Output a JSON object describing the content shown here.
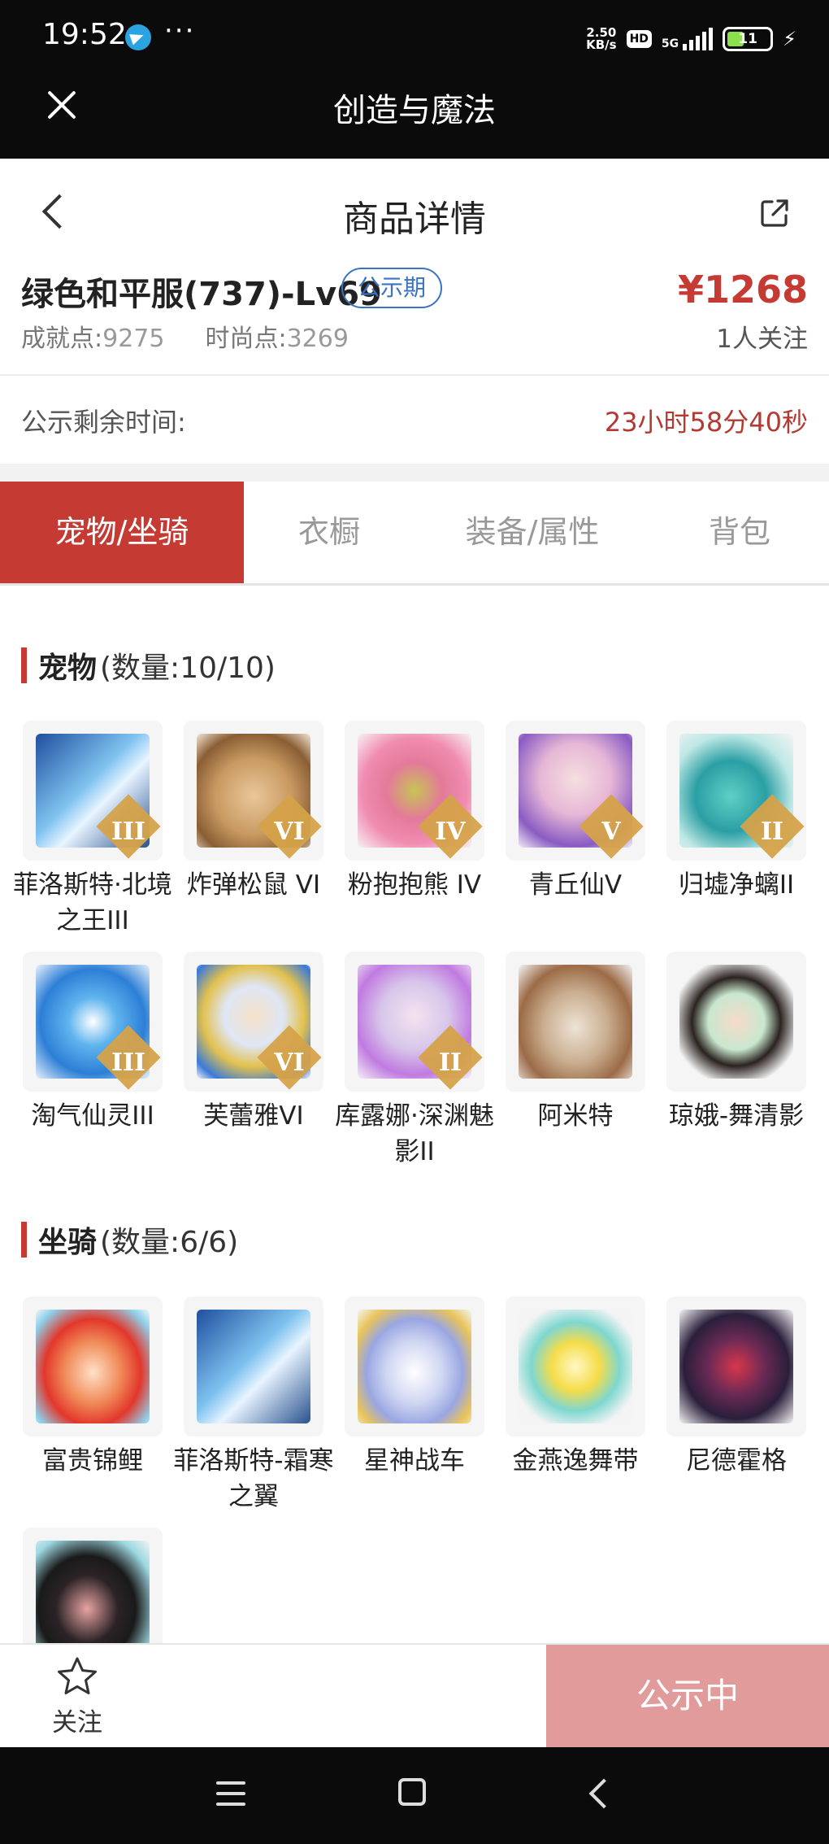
{
  "status_bar": {
    "time": "19:52",
    "speed_value": "2.50",
    "speed_unit": "KB/s",
    "hd": "HD",
    "network": "5G",
    "battery": "11"
  },
  "app_bar": {
    "title": "创造与魔法"
  },
  "header": {
    "title": "商品详情"
  },
  "product": {
    "name": "绿色和平服(737)-Lv69",
    "badge": "公示期",
    "price": "¥1268",
    "achievement_label": "成就点:",
    "achievement_value": "9275",
    "fashion_label": "时尚点:",
    "fashion_value": "3269",
    "watchers": "1人关注"
  },
  "remaining": {
    "label": "公示剩余时间:",
    "value": "23小时58分40秒"
  },
  "tabs": [
    {
      "label": "宠物/坐骑"
    },
    {
      "label": "衣橱"
    },
    {
      "label": "装备/属性"
    },
    {
      "label": "背包"
    }
  ],
  "pets": {
    "title": "宠物",
    "count": "(数量:10/10)",
    "items": [
      {
        "name": "菲洛斯特·北境之王III",
        "tier": "III",
        "icon": "frost-king-icon"
      },
      {
        "name": "炸弹松鼠 VI",
        "tier": "VI",
        "icon": "bomb-squirrel-icon"
      },
      {
        "name": "粉抱抱熊 IV",
        "tier": "IV",
        "icon": "pink-bear-icon"
      },
      {
        "name": "青丘仙V",
        "tier": "V",
        "icon": "fox-fairy-icon"
      },
      {
        "name": "归墟净螭II",
        "tier": "II",
        "icon": "dragon-icon"
      },
      {
        "name": "淘气仙灵III",
        "tier": "III",
        "icon": "blue-puppy-icon"
      },
      {
        "name": "芙蕾雅VI",
        "tier": "VI",
        "icon": "freya-icon"
      },
      {
        "name": "库露娜·深渊魅影II",
        "tier": "II",
        "icon": "kuluna-icon"
      },
      {
        "name": "阿米特",
        "tier": "",
        "icon": "crocodile-icon"
      },
      {
        "name": "琼娥-舞清影",
        "tier": "",
        "icon": "dancer-icon"
      }
    ]
  },
  "mounts": {
    "title": "坐骑",
    "count": "(数量:6/6)",
    "items": [
      {
        "name": "富贵锦鲤",
        "icon": "koi-icon"
      },
      {
        "name": "菲洛斯特-霜寒之翼",
        "icon": "frost-wing-icon"
      },
      {
        "name": "星神战车",
        "icon": "star-chariot-icon"
      },
      {
        "name": "金燕逸舞带",
        "icon": "golden-swallow-icon"
      },
      {
        "name": "尼德霍格",
        "icon": "nidhogg-icon"
      },
      {
        "name": "",
        "icon": "pig-icon"
      }
    ]
  },
  "bottom": {
    "follow_label": "关注",
    "status_button": "公示中"
  },
  "colors": {
    "accent": "#c53a33",
    "badge": "#3a72c4",
    "disabled_button": "#e19b9b"
  }
}
